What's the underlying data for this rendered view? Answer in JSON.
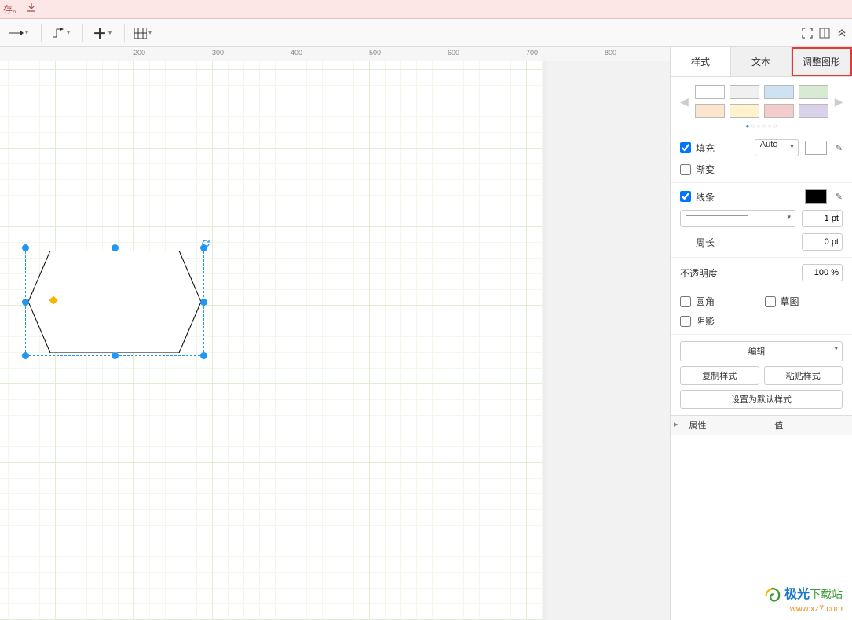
{
  "topbar": {
    "save_hint": "存。"
  },
  "ruler": {
    "marks": [
      200,
      300,
      400,
      500,
      600,
      700,
      800
    ]
  },
  "sidepanel": {
    "tabs": {
      "style": "样式",
      "text": "文本",
      "arrange": "调整图形"
    },
    "swatches": {
      "row1": [
        "#ffffff",
        "#f0f0f0",
        "#cfe2f3",
        "#d9ead3"
      ],
      "row2": [
        "#fce5cd",
        "#fff2cc",
        "#f4cccc",
        "#d9d2e9"
      ]
    },
    "fill": {
      "label": "填充",
      "checked": true,
      "mode": "Auto",
      "color": "#ffffff"
    },
    "gradient": {
      "label": "渐变",
      "checked": false
    },
    "line": {
      "label": "线条",
      "checked": true,
      "color": "#000000",
      "width": "1 pt"
    },
    "perimeter": {
      "label": "周长",
      "value": "0 pt"
    },
    "opacity": {
      "label": "不透明度",
      "value": "100 %"
    },
    "rounded": {
      "label": "圆角",
      "checked": false
    },
    "sketch": {
      "label": "草图",
      "checked": false
    },
    "shadow": {
      "label": "阴影",
      "checked": false
    },
    "edit": {
      "label": "编辑"
    },
    "copy_style": "复制样式",
    "paste_style": "粘贴样式",
    "set_default": "设置为默认样式",
    "prop_header": {
      "attr": "属性",
      "value": "值"
    }
  },
  "logo": {
    "name1": "极光",
    "name2": "下载站",
    "url": "www.xz7.com"
  }
}
